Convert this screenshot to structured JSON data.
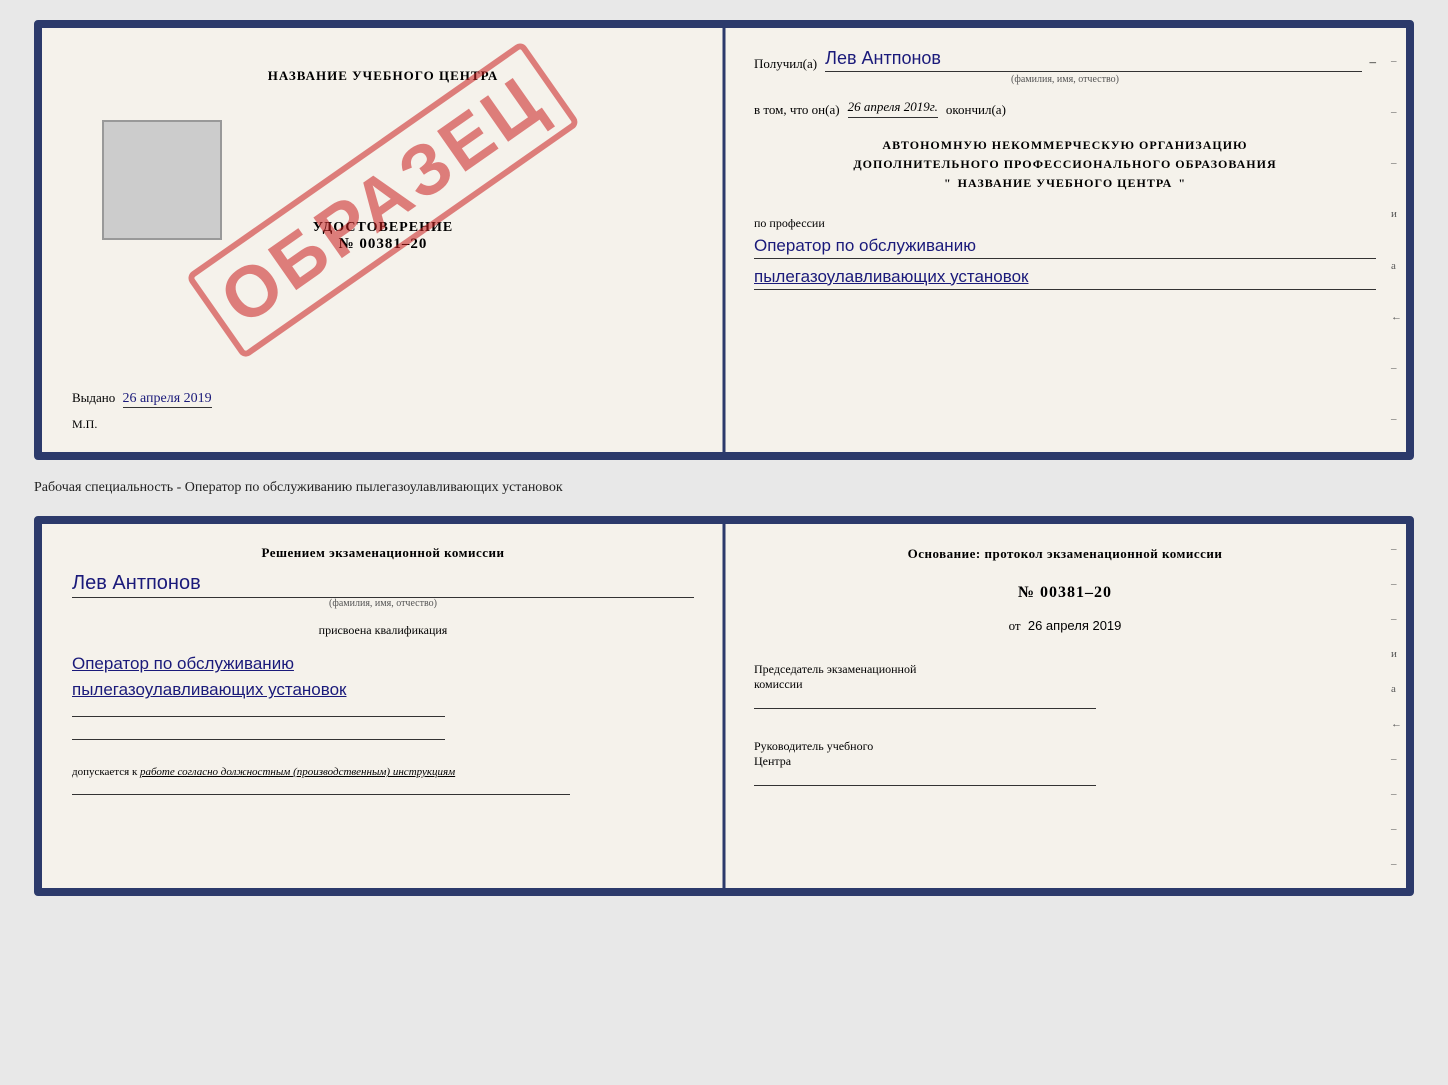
{
  "page": {
    "bg_color": "#e8e8e8"
  },
  "top_card": {
    "left": {
      "title": "НАЗВАНИЕ УЧЕБНОГО ЦЕНТРА",
      "stamp_placeholder": "",
      "obrazets": "ОБРАЗЕЦ",
      "udostoverenie_label": "УДОСТОВЕРЕНИЕ",
      "number": "№ 00381–20",
      "vidano_label": "Выдано",
      "vidano_date": "26 апреля 2019",
      "mp_label": "М.П."
    },
    "right": {
      "poluchil_label": "Получил(а)",
      "recipient_name": "Лев Антпонов",
      "fio_sub": "(фамилия, имя, отчество)",
      "vtom_label": "в том, что он(а)",
      "vtom_date": "26 апреля 2019г.",
      "okonchil_label": "окончил(а)",
      "org_line1": "АВТОНОМНУЮ НЕКОММЕРЧЕСКУЮ ОРГАНИЗАЦИЮ",
      "org_line2": "ДОПОЛНИТЕЛЬНОГО ПРОФЕССИОНАЛЬНОГО ОБРАЗОВАНИЯ",
      "org_quote1": "\"",
      "org_name": "НАЗВАНИЕ УЧЕБНОГО ЦЕНТРА",
      "org_quote2": "\"",
      "profession_label": "по профессии",
      "profession_line1": "Оператор по обслуживанию",
      "profession_line2": "пылегазоулавливающих установок"
    }
  },
  "separator": {
    "text": "Рабочая специальность - Оператор по обслуживанию пылегазоулавливающих установок"
  },
  "bottom_card": {
    "left": {
      "decision_title": "Решением экзаменационной комиссии",
      "name": "Лев Антпонов",
      "fio_sub": "(фамилия, имя, отчество)",
      "prisvoena_label": "присвоена квалификация",
      "qual_line1": "Оператор по обслуживанию",
      "qual_line2": "пылегазоулавливающих установок",
      "допускается_label": "допускается к",
      "допускается_value": "работе согласно должностным (производственным) инструкциям"
    },
    "right": {
      "osnov_label": "Основание: протокол экзаменационной комиссии",
      "protocol_number": "№  00381–20",
      "ot_label": "от",
      "ot_date": "26 апреля 2019",
      "predsedatel_line1": "Председатель экзаменационной",
      "predsedatel_line2": "комиссии",
      "rukovodit_line1": "Руководитель учебного",
      "rukovodit_line2": "Центра"
    }
  },
  "edge_marks": [
    "–",
    "–",
    "–",
    "и",
    "а",
    "←",
    "–",
    "–",
    "–",
    "–"
  ]
}
